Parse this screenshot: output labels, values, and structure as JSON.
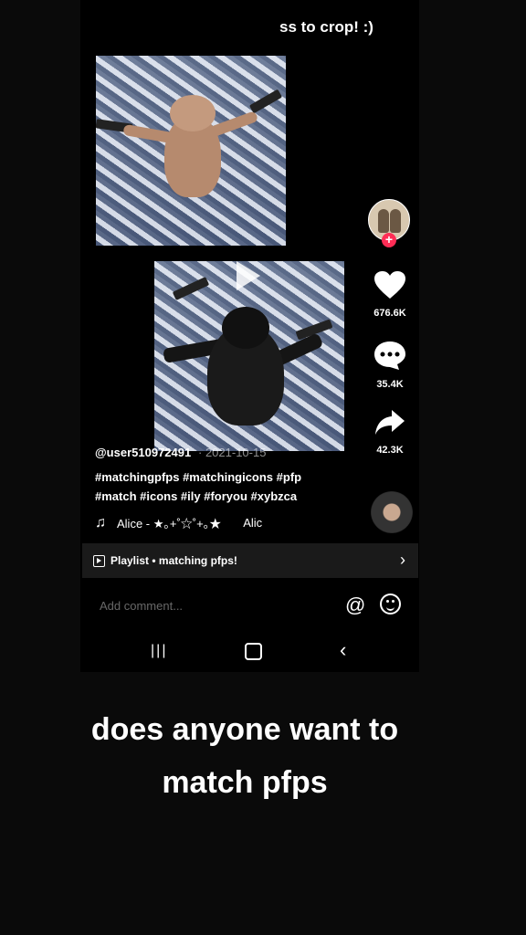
{
  "top_caption": "ss to crop! :)",
  "actions": {
    "likes": "676.6K",
    "comments": "35.4K",
    "shares": "42.3K"
  },
  "post": {
    "username": "@user510972491",
    "date": "· 2021-10-15",
    "hashtags_line1": "#matchingpfps #matchingicons #pfp",
    "hashtags_line2": "#match  #icons #ily #foryou #xybzca",
    "music_title": "Alice - ★｡+˚☆˚+｡★",
    "music_title_repeat": "Alic"
  },
  "playlist": {
    "label": "Playlist • matching pfps!"
  },
  "comment_input": {
    "placeholder": "Add comment..."
  },
  "bottom_caption": {
    "line1": "does anyone want to",
    "line2": "match pfps"
  },
  "colors": {
    "accent": "#fe2c55",
    "background": "#000000"
  }
}
